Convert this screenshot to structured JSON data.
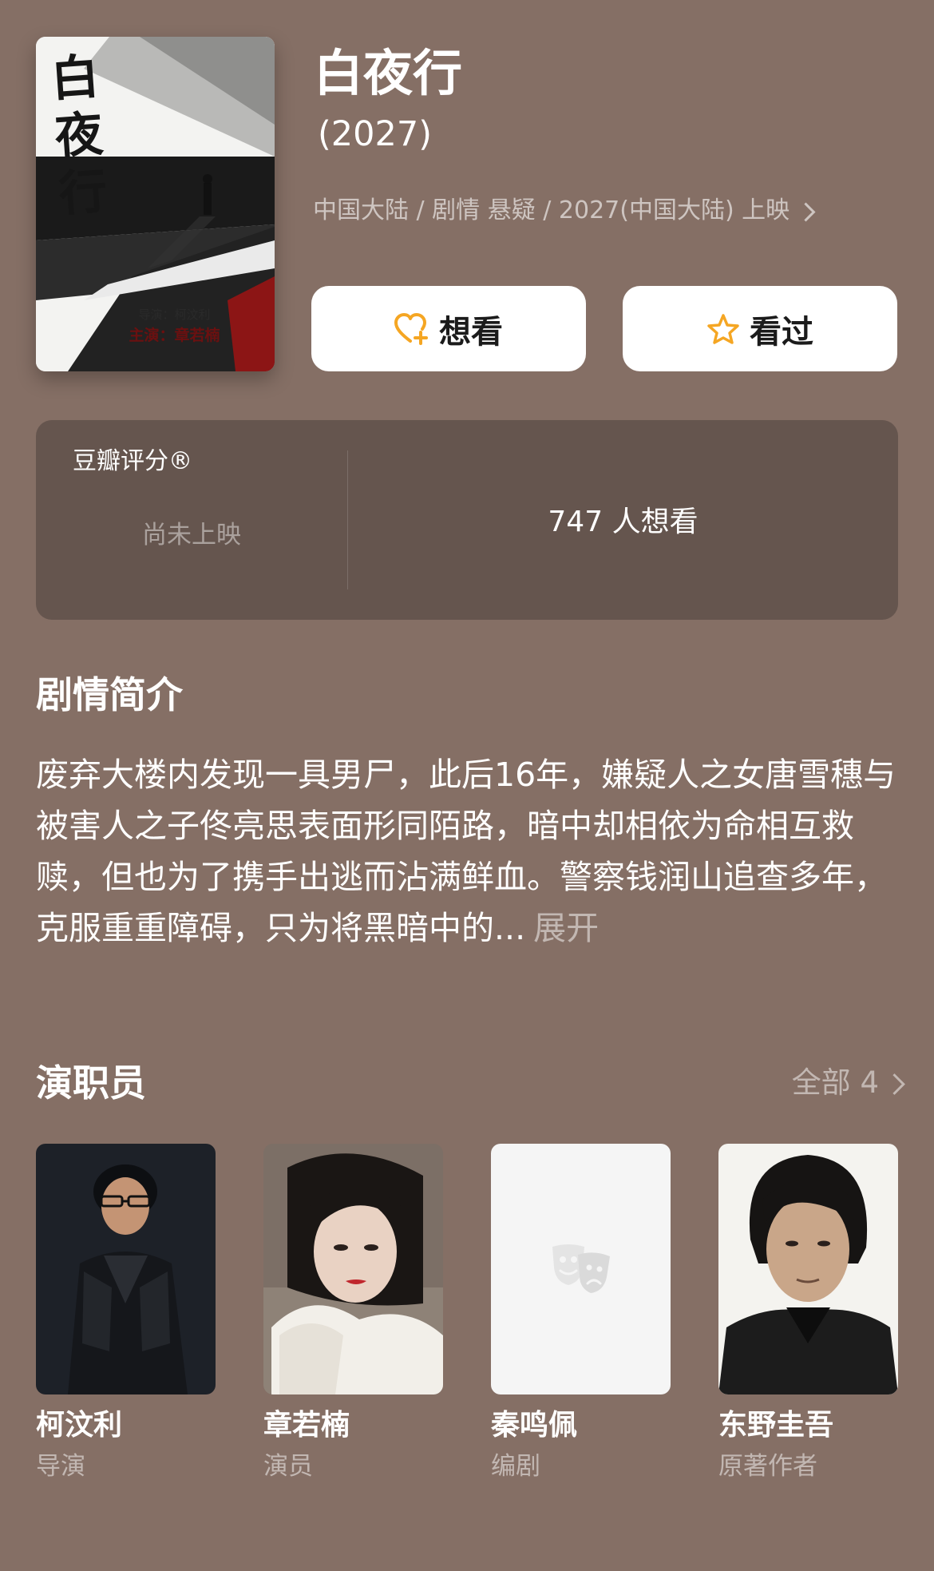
{
  "movie": {
    "title": "白夜行",
    "year": "(2027)",
    "meta": "中国大陆 / 剧情 悬疑 / 2027(中国大陆) 上映",
    "poster": {
      "title_chars": "白夜行",
      "credit_director": "导演：柯汶利",
      "credit_cast": "主演：章若楠"
    }
  },
  "actions": {
    "wish_label": "想看",
    "seen_label": "看过"
  },
  "rating": {
    "label": "豆瓣评分®",
    "status": "尚未上映",
    "wish_count": "747 人想看"
  },
  "synopsis": {
    "title": "剧情简介",
    "text": "废弃大楼内发现一具男尸，此后16年，嫌疑人之女唐雪穗与被害人之子佟亮思表面形同陌路，暗中却相依为命相互救赎，但也为了携手出逃而沾满鲜血。警察钱润山追查多年，克服重重障碍，只为将黑暗中的...",
    "expand_label": "展开"
  },
  "cast": {
    "title": "演职员",
    "see_all_label": "全部 4",
    "members": [
      {
        "name": "柯汶利",
        "role": "导演"
      },
      {
        "name": "章若楠",
        "role": "演员"
      },
      {
        "name": "秦鸣佩",
        "role": "编剧"
      },
      {
        "name": "东野圭吾",
        "role": "原著作者"
      }
    ]
  },
  "colors": {
    "background": "#856f65",
    "panel": "#65554e",
    "accent_orange": "#f5a623"
  }
}
